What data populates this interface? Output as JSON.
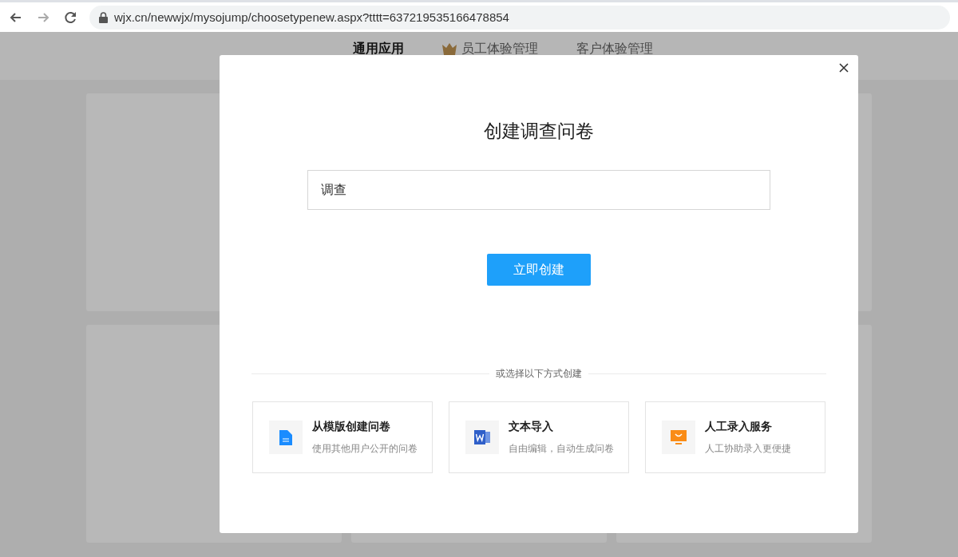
{
  "browser": {
    "url": "wjx.cn/newwjx/mysojump/choosetypenew.aspx?tttt=637219535166478854"
  },
  "nav_tabs": [
    {
      "label": "通用应用",
      "selected": true
    },
    {
      "label": "员工体验管理",
      "selected": false,
      "kind": "crown"
    },
    {
      "label": "客户体验管理",
      "selected": false
    }
  ],
  "dialog": {
    "title": "创建调查问卷",
    "name_field": {
      "value": "调查"
    },
    "create_button": "立即创建",
    "divider_text": "或选择以下方式创建",
    "options": [
      {
        "kind": "document",
        "title": "从模版创建问卷",
        "description": "使用其他用户公开的问卷"
      },
      {
        "kind": "word",
        "title": "文本导入",
        "description": "自由编辑，自动生成问卷"
      },
      {
        "kind": "screen",
        "title": "人工录入服务",
        "description": "人工协助录入更便捷"
      }
    ]
  }
}
